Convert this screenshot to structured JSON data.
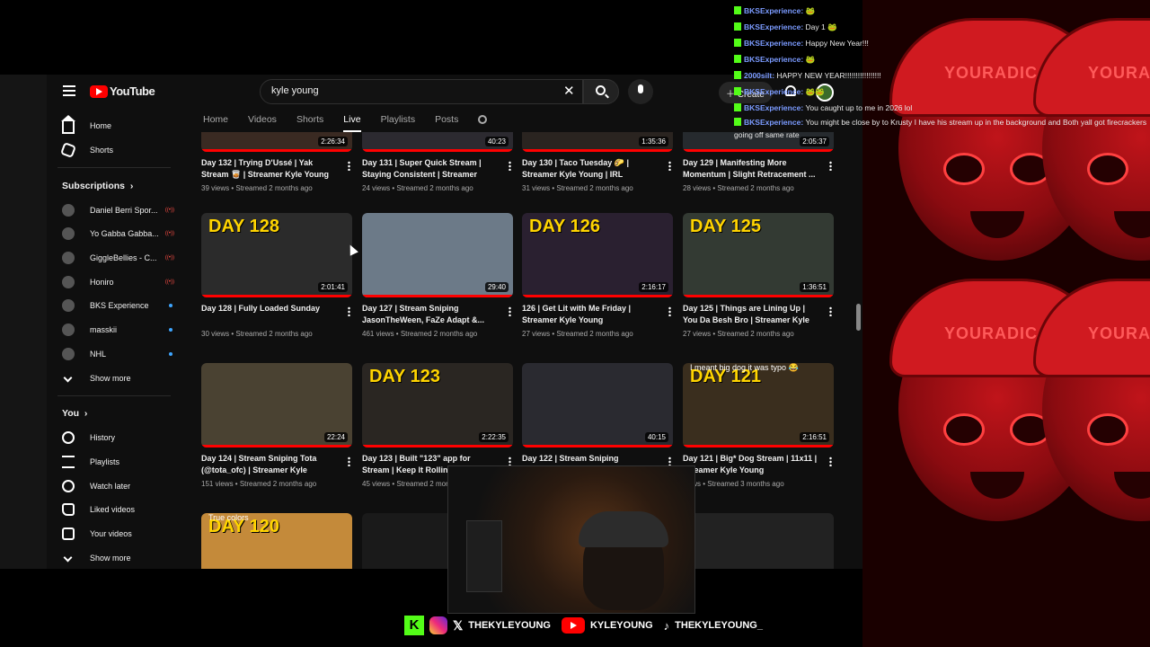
{
  "youtube": {
    "logo_text": "YouTube",
    "search_value": "kyle young",
    "create_label": "Create",
    "tabs": [
      "Home",
      "Videos",
      "Shorts",
      "Live",
      "Playlists",
      "Posts"
    ],
    "active_tab": "Live"
  },
  "sidebar": {
    "main": [
      {
        "label": "Home",
        "icon": "home-icon"
      },
      {
        "label": "Shorts",
        "icon": "shorts-icon"
      }
    ],
    "subscriptions_title": "Subscriptions",
    "subscriptions": [
      {
        "label": "Daniel Berri Spor...",
        "status": "live"
      },
      {
        "label": "Yo Gabba Gabba...",
        "status": "live"
      },
      {
        "label": "GiggleBellies - C...",
        "status": "live"
      },
      {
        "label": "Honiro",
        "status": "live"
      },
      {
        "label": "BKS Experience",
        "status": "new"
      },
      {
        "label": "masskii",
        "status": "new"
      },
      {
        "label": "NHL",
        "status": "new"
      }
    ],
    "show_more": "Show more",
    "you_title": "You",
    "you_items": [
      {
        "label": "History",
        "icon": "history-icon"
      },
      {
        "label": "Playlists",
        "icon": "playlists-icon"
      },
      {
        "label": "Watch later",
        "icon": "watch-later-icon"
      },
      {
        "label": "Liked videos",
        "icon": "liked-icon"
      },
      {
        "label": "Your videos",
        "icon": "your-videos-icon"
      }
    ],
    "show_more_2": "Show more"
  },
  "videos": [
    {
      "title": "Day 132 | Trying D'Ussé | Yak Stream 🥃 | Streamer Kyle Young",
      "views": "39 views",
      "age": "Streamed 2 months ago",
      "duration": "2:26:34",
      "overlay": "",
      "thumb": "#3a2a22"
    },
    {
      "title": "Day 131 | Super Quick Stream | Staying Consistent | Streamer Kyle...",
      "views": "24 views",
      "age": "Streamed 2 months ago",
      "duration": "40:23",
      "overlay": "",
      "thumb": "#2c2a30"
    },
    {
      "title": "Day 130 | Taco Tuesday 🌮 | Streamer Kyle Young | IRL",
      "views": "31 views",
      "age": "Streamed 2 months ago",
      "duration": "1:35:36",
      "overlay": "",
      "thumb": "#2a2420"
    },
    {
      "title": "Day 129 | Manifesting More Momentum | Slight Retracement ...",
      "views": "28 views",
      "age": "Streamed 2 months ago",
      "duration": "2:05:37",
      "overlay": "",
      "thumb": "#262a2e"
    },
    {
      "title": "Day 128 | Fully Loaded Sunday",
      "views": "30 views",
      "age": "Streamed 2 months ago",
      "duration": "2:01:41",
      "overlay": "DAY 128",
      "thumb": "#2b2b2b"
    },
    {
      "title": "Day 127 | Stream Sniping JasonTheWeen, FaZe Adapt &...",
      "views": "461 views",
      "age": "Streamed 2 months ago",
      "duration": "29:40",
      "overlay": "",
      "thumb": "#6c7a88"
    },
    {
      "title": "126 | Get Lit with Me Friday | Streamer Kyle Young",
      "views": "27 views",
      "age": "Streamed 2 months ago",
      "duration": "2:16:17",
      "overlay": "DAY 126",
      "thumb": "#2a2030"
    },
    {
      "title": "Day 125 | Things are Lining Up | You Da Besh Bro | Streamer Kyle Young",
      "views": "27 views",
      "age": "Streamed 2 months ago",
      "duration": "1:36:51",
      "overlay": "DAY 125",
      "thumb": "#333a33"
    },
    {
      "title": "Day 124 | Stream Sniping Tota (@tota_ofc) | Streamer Kyle Young...",
      "views": "151 views",
      "age": "Streamed 2 months ago",
      "duration": "22:24",
      "overlay": "",
      "thumb": "#4a4232"
    },
    {
      "title": "Day 123 | Built \"123\" app for Stream | Keep It Rolling 🎲 | Str...",
      "views": "45 views",
      "age": "Streamed 2 months ago",
      "duration": "2:22:35",
      "overlay": "DAY 123",
      "thumb": "#2a2622"
    },
    {
      "title": "Day 122 | Stream Sniping",
      "views": "",
      "age": "",
      "duration": "40:15",
      "overlay": "",
      "thumb": "#2a2a30"
    },
    {
      "title": "Day 121 | Big* Dog Stream | 11x11 | Streamer Kyle Young",
      "views": "views",
      "age": "Streamed 3 months ago",
      "duration": "2:16:51",
      "overlay": "DAY 121",
      "thumb": "#3a2e1e",
      "caption": "I meant big dog it was typo 😂"
    },
    {
      "title": "",
      "views": "",
      "age": "",
      "duration": "",
      "overlay": "DAY 120",
      "thumb": "#c48a3a",
      "caption": "True colors"
    },
    {
      "title": "",
      "views": "",
      "age": "",
      "duration": "",
      "overlay": "",
      "thumb": "#1a1a1a"
    },
    {
      "title": "",
      "views": "",
      "age": "",
      "duration": "",
      "overlay": "",
      "thumb": "#1f1f1f"
    },
    {
      "title": "",
      "views": "",
      "age": "",
      "duration": "",
      "overlay": "",
      "thumb": "#222222"
    }
  ],
  "chat": [
    {
      "user": "BKSExperience",
      "message": "🐸"
    },
    {
      "user": "BKSExperience",
      "message": "Day 1 🐸"
    },
    {
      "user": "BKSExperience",
      "message": "Happy New Year!!!"
    },
    {
      "user": "BKSExperience",
      "message": "🐸"
    },
    {
      "user": "2000silt",
      "message": "HAPPY NEW YEAR!!!!!!!!!!!!!!!!!"
    },
    {
      "user": "BKSExperience",
      "message": "🐸🐸"
    },
    {
      "user": "BKSExperience",
      "message": "You caught up to me in 2026 lol"
    },
    {
      "user": "BKSExperience",
      "message": "You might be close by to Krusty I have his stream up in the background and Both yall got firecrackers going off same rate"
    }
  ],
  "brand": {
    "cap_text": "YOURADICA"
  },
  "socials": [
    {
      "icon": "kick-icon",
      "label": ""
    },
    {
      "icon": "instagram-icon",
      "label": ""
    },
    {
      "icon": "x-icon",
      "label": "THEKYLEYOUNG"
    },
    {
      "icon": "youtube-icon",
      "label": "KYLEYOUNG"
    },
    {
      "icon": "tiktok-icon",
      "label": "THEKYLEYOUNG_"
    }
  ],
  "colors": {
    "accent": "#ff0000",
    "kick": "#53fc18",
    "chat_user": "#7b9bff"
  }
}
